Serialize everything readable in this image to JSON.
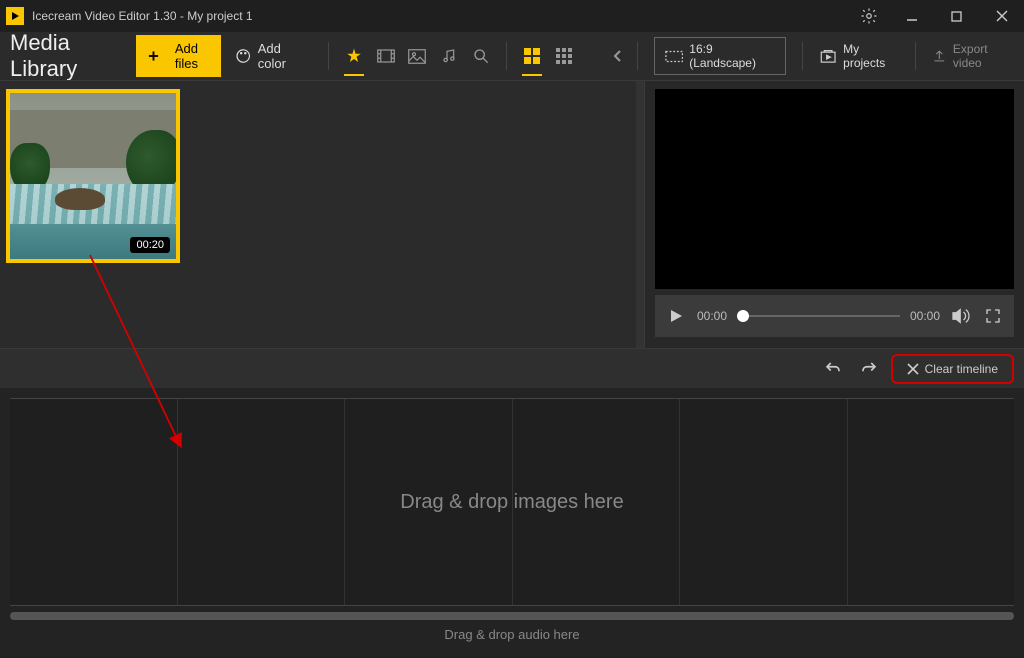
{
  "titlebar": {
    "app": "Icecream Video Editor 1.30",
    "project": "My project 1"
  },
  "library": {
    "title": "Media Library",
    "add_files": "Add files",
    "add_color": "Add color"
  },
  "thumb": {
    "duration": "00:20"
  },
  "top_right": {
    "aspect": "16:9 (Landscape)",
    "my_projects": "My projects",
    "export": "Export video"
  },
  "player": {
    "current": "00:00",
    "total": "00:00"
  },
  "timeline": {
    "clear": "Clear timeline",
    "drop_images": "Drag & drop images here",
    "drop_audio": "Drag & drop audio here"
  }
}
